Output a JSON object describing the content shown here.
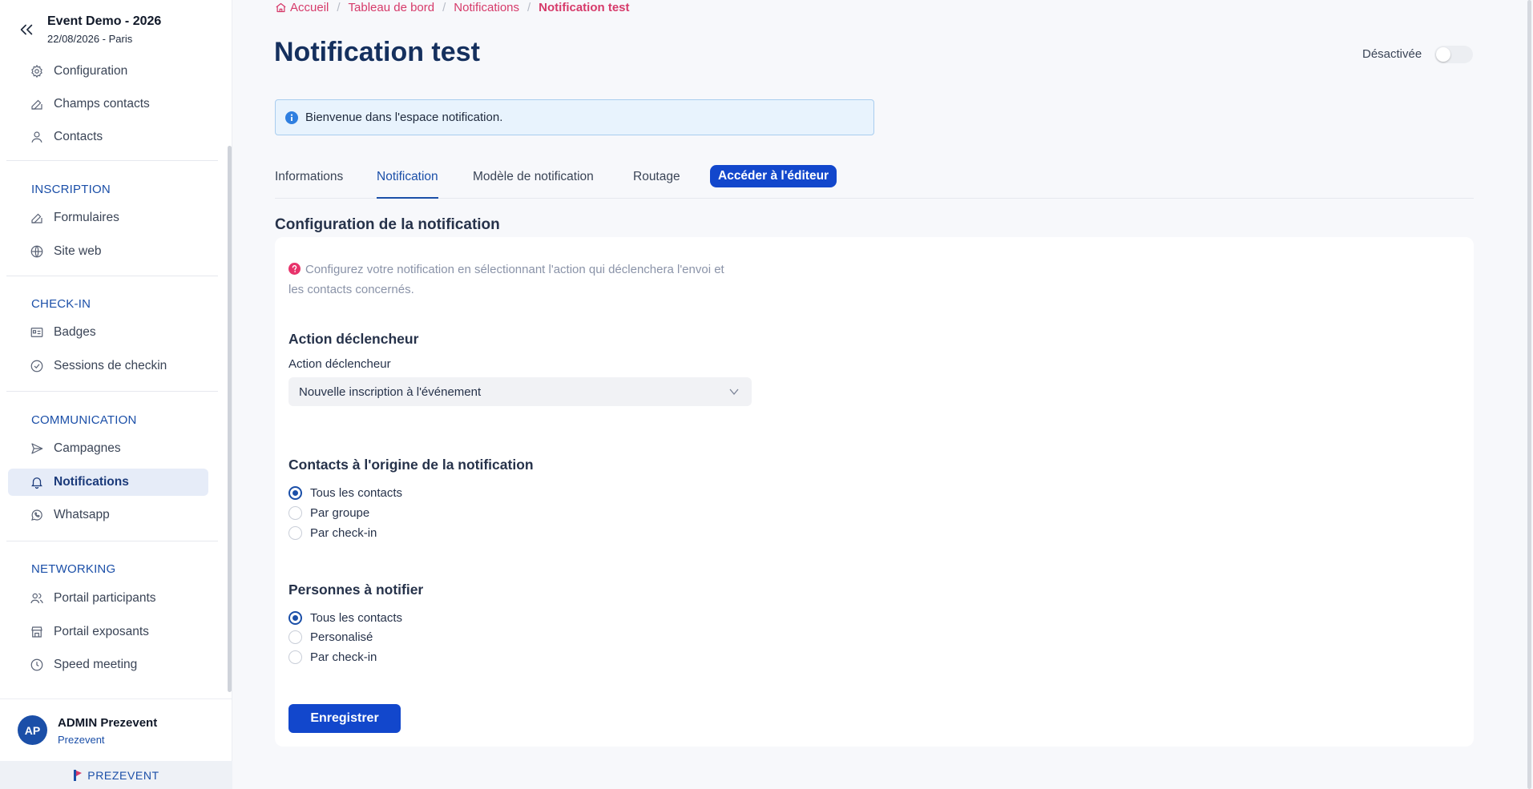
{
  "event": {
    "title": "Event Demo - 2026",
    "subtitle": "22/08/2026 - Paris"
  },
  "sidebar": {
    "top_items": [
      {
        "label": "Configuration",
        "icon": "gear-icon"
      },
      {
        "label": "Champs contacts",
        "icon": "edit-icon"
      },
      {
        "label": "Contacts",
        "icon": "user-icon"
      }
    ],
    "sections": [
      {
        "title": "INSCRIPTION",
        "items": [
          {
            "label": "Formulaires",
            "icon": "edit-icon"
          },
          {
            "label": "Site web",
            "icon": "globe-icon"
          }
        ]
      },
      {
        "title": "CHECK-IN",
        "items": [
          {
            "label": "Badges",
            "icon": "badge-icon"
          },
          {
            "label": "Sessions de checkin",
            "icon": "check-circle-icon"
          }
        ]
      },
      {
        "title": "COMMUNICATION",
        "items": [
          {
            "label": "Campagnes",
            "icon": "send-icon"
          },
          {
            "label": "Notifications",
            "icon": "bell-icon",
            "active": true
          },
          {
            "label": "Whatsapp",
            "icon": "whatsapp-icon"
          }
        ]
      },
      {
        "title": "NETWORKING",
        "items": [
          {
            "label": "Portail participants",
            "icon": "users-icon"
          },
          {
            "label": "Portail exposants",
            "icon": "store-icon"
          },
          {
            "label": "Speed meeting",
            "icon": "clock-icon"
          }
        ]
      }
    ]
  },
  "user": {
    "initials": "AP",
    "name": "ADMIN Prezevent",
    "org": "Prezevent"
  },
  "brand": {
    "name": "PREZEVENT"
  },
  "breadcrumb": {
    "home": "Accueil",
    "dashboard": "Tableau de bord",
    "section": "Notifications",
    "current": "Notification test"
  },
  "page": {
    "title": "Notification test",
    "toggle_label": "Désactivée",
    "toggle_on": false
  },
  "banner": {
    "text": "Bienvenue dans l'espace notification."
  },
  "tabs": {
    "informations": "Informations",
    "notification": "Notification",
    "template": "Modèle de notification",
    "routing": "Routage",
    "editor": "Accéder à l'éditeur"
  },
  "config": {
    "heading": "Configuration de la notification",
    "help": "Configurez votre notification en sélectionnant l'action qui déclenchera l'envoi et les contacts concernés.",
    "trigger": {
      "heading": "Action déclencheur",
      "label": "Action déclencheur",
      "value": "Nouvelle inscription à l'événement"
    },
    "origin": {
      "heading": "Contacts à l'origine de la notification",
      "options": [
        "Tous les contacts",
        "Par groupe",
        "Par check-in"
      ],
      "selected": "Tous les contacts"
    },
    "recipients": {
      "heading": "Personnes à notifier",
      "options": [
        "Tous les contacts",
        "Personalisé",
        "Par check-in"
      ],
      "selected": "Tous les contacts"
    },
    "save_label": "Enregistrer"
  },
  "colors": {
    "primary": "#1247cc",
    "accent": "#d63a6a",
    "title": "#15305e"
  }
}
